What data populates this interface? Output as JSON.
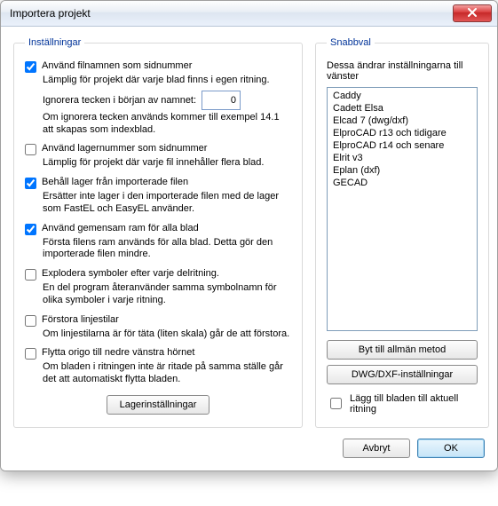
{
  "window": {
    "title": "Importera projekt"
  },
  "settings": {
    "legend": "Inställningar",
    "opts": [
      {
        "checked": true,
        "label": "Använd filnamnen som sidnummer",
        "sub1": "Lämplig för projekt där varje blad finns i egen ritning.",
        "ignore_label": "Ignorera tecken i början av namnet:",
        "ignore_value": "0",
        "sub2": "Om ignorera tecken används kommer till exempel 14.1 att skapas som indexblad."
      },
      {
        "checked": false,
        "label": "Använd lagernummer som sidnummer",
        "sub1": "Lämplig för projekt där varje fil innehåller flera blad."
      },
      {
        "checked": true,
        "label": "Behåll lager från importerade filen",
        "sub1": "Ersätter inte lager i den importerade filen med de lager som FastEL och EasyEL använder."
      },
      {
        "checked": true,
        "label": "Använd gemensam ram för alla blad",
        "sub1": "Första filens ram används för alla blad. Detta gör den importerade filen mindre."
      },
      {
        "checked": false,
        "label": "Explodera symboler efter varje delritning.",
        "sub1": "En del program återanvänder samma symbolnamn för olika symboler i varje ritning."
      },
      {
        "checked": false,
        "label": "Förstora linjestilar",
        "sub1": "Om linjestilarna är för täta (liten skala) går de att förstora."
      },
      {
        "checked": false,
        "label": "Flytta origo till nedre vänstra hörnet",
        "sub1": "Om bladen i ritningen inte är ritade på samma ställe går det att automatiskt flytta bladen."
      }
    ],
    "layer_button": "Lagerinställningar"
  },
  "quick": {
    "legend": "Snabbval",
    "desc": "Dessa ändrar inställningarna till vänster",
    "items": [
      "Caddy",
      "Cadett Elsa",
      "Elcad 7 (dwg/dxf)",
      "ElproCAD r13 och tidigare",
      "ElproCAD r14 och senare",
      "Elrit v3",
      "Eplan (dxf)",
      "GECAD"
    ],
    "btn_general": "Byt till allmän metod",
    "btn_dwgdxf": "DWG/DXF-inställningar",
    "add_label": "Lägg till bladen till aktuell ritning",
    "add_checked": false
  },
  "footer": {
    "cancel": "Avbryt",
    "ok": "OK"
  }
}
